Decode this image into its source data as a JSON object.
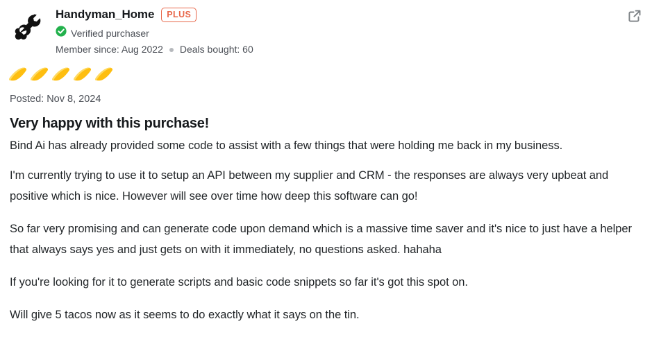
{
  "review": {
    "author": {
      "username": "Handyman_Home",
      "badge_label": "PLUS",
      "badge_color": "#e8674a",
      "avatar_icon": "plug-wrench-icon",
      "verified_label": "Verified purchaser",
      "verified_icon": "verified-check-icon",
      "verified_color": "#22b14c",
      "member_since": "Member since: Aug 2022",
      "deals_bought": "Deals bought: 60"
    },
    "actions": {
      "external_link_icon": "external-link-icon"
    },
    "rating": {
      "icon": "taco-icon",
      "value": 5,
      "max": 5,
      "color": "#febe10",
      "highlight_color": "#ffd84d"
    },
    "posted": "Posted: Nov 8, 2024",
    "title": "Very happy with this purchase!",
    "paragraphs": [
      "Bind Ai has already provided some code to assist with a few things that were holding me back in my business.",
      "I'm currently trying to use it to setup an API between my supplier and CRM - the responses are always very upbeat and positive which is nice. However will see over time how deep this software can go!",
      "So far very promising and can generate code upon demand which is a massive time saver and it's nice to just have a helper that always says yes and just gets on with it immediately, no questions asked. hahaha",
      "If you're looking for it to generate scripts and basic code snippets so far it's got this spot on.",
      "Will give 5 tacos now as it seems to do exactly what it says on the tin."
    ]
  }
}
